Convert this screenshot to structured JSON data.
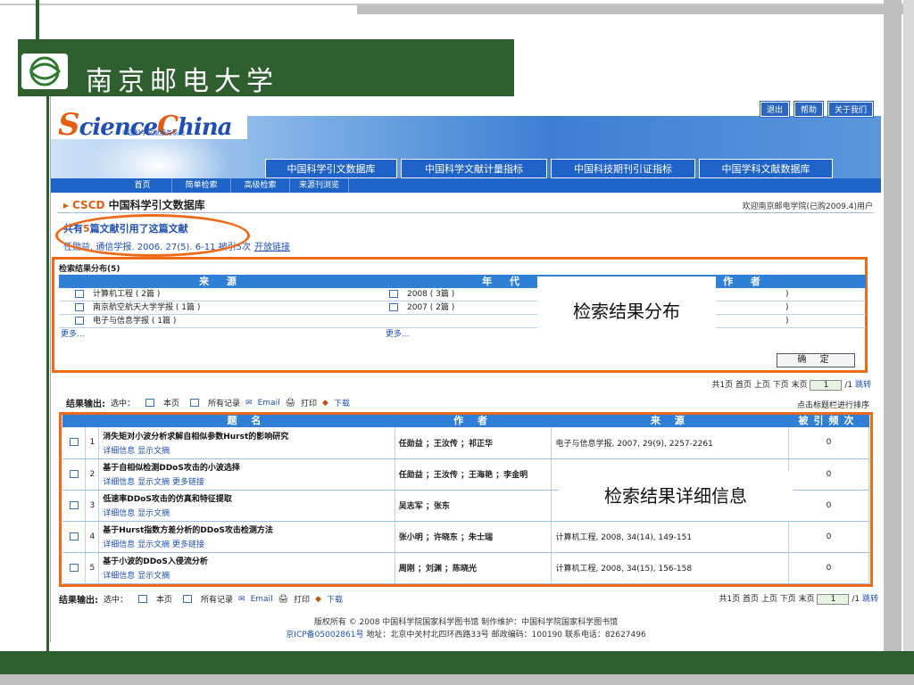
{
  "university": {
    "name": "南京邮电大学"
  },
  "sc": {
    "logo": "ScienceChina",
    "logo_s": "S",
    "logo_rest": "cience",
    "logo_c": "C",
    "logo_end": "hina",
    "logo_sub": "中国科学文献服务系统",
    "top_buttons": [
      "退出",
      "帮助",
      "关于我们"
    ],
    "db_tabs": [
      "中国科学引文数据库",
      "中国科学文献计量指标",
      "中国科技期刊引证指标",
      "中国学科文献数据库"
    ],
    "nav": [
      "首页",
      "简单检索",
      "高级检索",
      "来源刊浏览"
    ],
    "db_title_prefix": "CSCD",
    "db_title": "中国科学引文数据库",
    "welcome": "欢迎南京邮电学院(已购2009.4)用户"
  },
  "cited": {
    "prefix": "共有",
    "count": "5",
    "suffix": "篇文献引用了这篇文献"
  },
  "article": {
    "text": "任勋益. 通信学报. 2006. 27(5). 6-11 被引5次",
    "open_link": "开放链接"
  },
  "distribution": {
    "title": "检索结果分布(5)",
    "headers": [
      "来 源",
      "年 代",
      "作 者"
    ],
    "sources": [
      "计算机工程 ( 2篇 )",
      "南京航空航天大学学报 ( 1篇 )",
      "电子与信息学报 ( 1篇 )"
    ],
    "years": [
      "2008 ( 3篇 )",
      "2007 ( 2篇 )"
    ],
    "authors": [
      ")",
      ")",
      ")"
    ],
    "more": "更多...",
    "confirm": "确 定"
  },
  "callouts": {
    "distribution": "检索结果分布",
    "details": "检索结果详细信息"
  },
  "paging": {
    "text": "共1页 首页 上页 下页 末页",
    "page_value": "1",
    "total": "/1",
    "go": "跳转"
  },
  "output": {
    "label": "结果输出:",
    "select": "选中：",
    "this_page": "本页",
    "all_records": "所有记录",
    "email": "Email",
    "print": "打印",
    "download": "下载"
  },
  "sort_hint": "点击标题栏进行排序",
  "results": {
    "headers": [
      "题 名",
      "作 者",
      "来 源",
      "被引频次"
    ],
    "rows": [
      {
        "num": "1",
        "title": "消失矩对小波分析求解自相似参数Hurst的影响研究",
        "links": "详细信息  显示文摘",
        "authors": "任勋益 ；王汝传 ；祁正华",
        "source": "电子与信息学报, 2007, 29(9), 2257-2261",
        "cited": "0"
      },
      {
        "num": "2",
        "title": "基于自相似检测DDoS攻击的小波选择",
        "links": "详细信息  显示文摘  更多链接",
        "authors": "任勋益 ；王汝传 ；王海艳 ；李金明",
        "source": "",
        "cited": "0"
      },
      {
        "num": "3",
        "title": "低速率DDoS攻击的仿真和特征提取",
        "links": "详细信息  显示文摘",
        "authors": "吴志军 ；张东",
        "source": "",
        "cited": "0"
      },
      {
        "num": "4",
        "title": "基于Hurst指数方差分析的DDoS攻击检测方法",
        "links": "详细信息  显示文摘  更多链接",
        "authors": "张小明 ；许晓东 ；朱士瑞",
        "source": "计算机工程, 2008, 34(14), 149-151",
        "cited": "0"
      },
      {
        "num": "5",
        "title": "基于小波的DDoS入侵流分析",
        "links": "详细信息  显示文摘",
        "authors": "周刚 ；刘渊 ；陈晓光",
        "source": "计算机工程, 2008, 34(15), 156-158",
        "cited": "0"
      }
    ]
  },
  "footer": {
    "line1": "版权所有 © 2008 中国科学院国家科学图书馆  制作维护：中国科学院国家科学图书馆",
    "icp": "京ICP备05002861号",
    "line2": "地址：北京中关村北四环西路33号  邮政编码：100190  联系电话：82627496"
  },
  "colors": {
    "frame_green": "#2f5f2f",
    "accent_orange": "#ee6a17",
    "header_blue": "#2f7fd6"
  }
}
